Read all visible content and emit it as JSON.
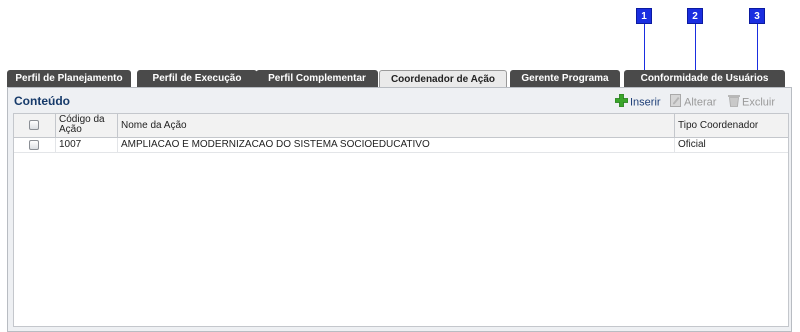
{
  "markers": [
    "1",
    "2",
    "3"
  ],
  "tabs": [
    {
      "label": "Perfil de Planejamento",
      "active": false
    },
    {
      "label": "Perfil de Execução",
      "active": false
    },
    {
      "label": "Perfil Complementar",
      "active": false
    },
    {
      "label": "Coordenador de Ação",
      "active": true
    },
    {
      "label": "Gerente Programa",
      "active": false
    },
    {
      "label": "Conformidade de Usuários",
      "active": false
    }
  ],
  "panel": {
    "title": "Conteúdo",
    "toolbar": {
      "insert_label": "Inserir",
      "alter_label": "Alterar",
      "delete_label": "Excluir"
    }
  },
  "grid": {
    "columns": [
      "",
      "Código da Ação",
      "Nome da Ação",
      "Tipo Coordenador"
    ],
    "rows": [
      {
        "codigo": "1007",
        "nome": "AMPLIACAO E MODERNIZACAO DO SISTEMA SOCIOEDUCATIVO",
        "tipo": "Oficial"
      }
    ]
  },
  "colors": {
    "marker": "#1a2ee0",
    "tab_bg": "#4a4a4a",
    "title": "#163a6a",
    "insert_icon": "#3aa52a"
  }
}
